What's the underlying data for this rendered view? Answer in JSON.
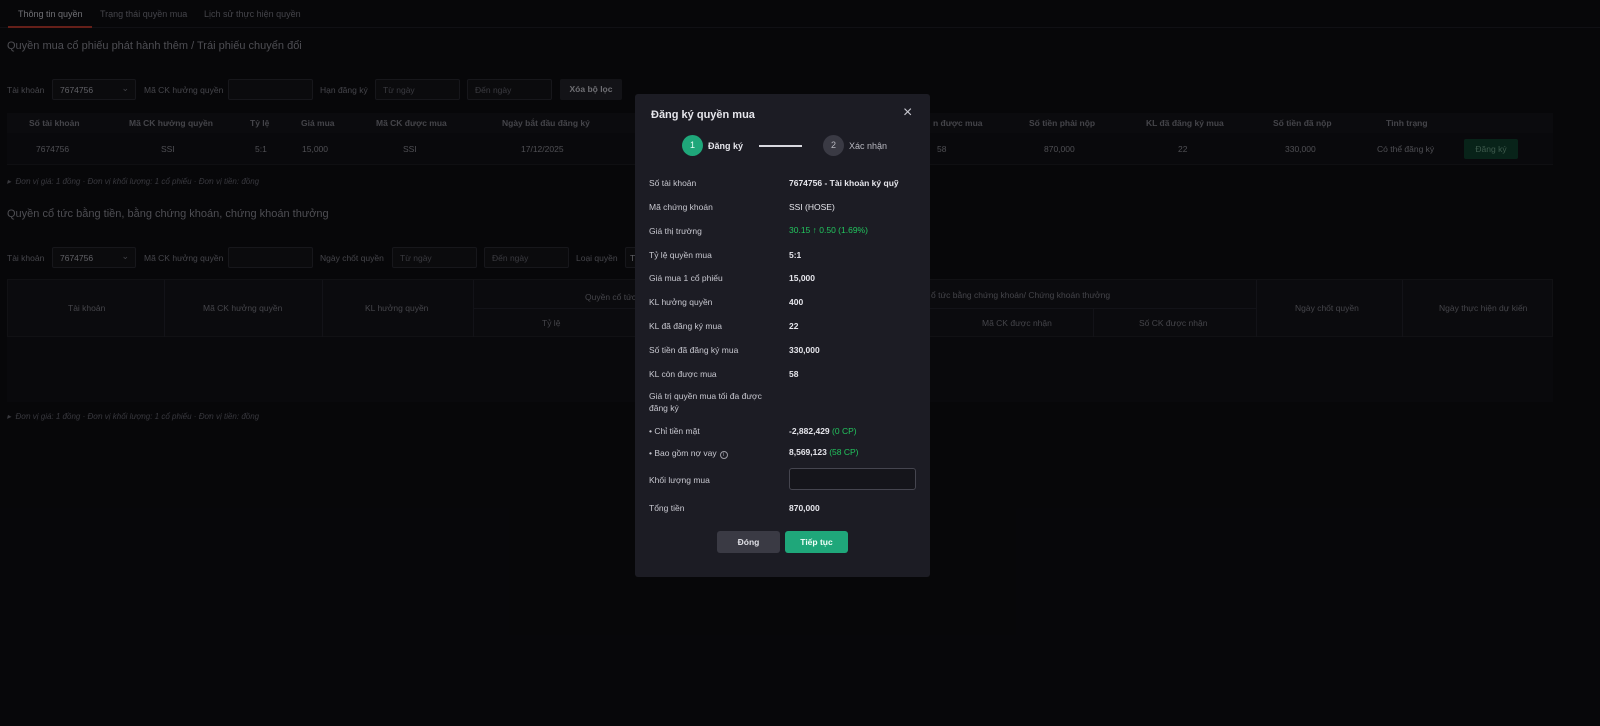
{
  "tabs": [
    "Thông tin quyền",
    "Trạng thái quyền mua",
    "Lịch sử thực hiện quyền"
  ],
  "section1": {
    "title": "Quyền mua cổ phiếu phát hành thêm / Trái phiếu chuyển đổi",
    "filters": {
      "account_label": "Tài khoản",
      "account_value": "7674756",
      "symbol_label": "Mã CK hưởng quyền",
      "deadline_label": "Hạn đăng ký",
      "from_placeholder": "Từ ngày",
      "to_placeholder": "Đến ngày",
      "clear_label": "Xóa bộ lọc"
    },
    "headers": [
      "Số tài khoản",
      "Mã CK hưởng quyền",
      "Tỷ lệ",
      "Giá mua",
      "Mã CK được mua",
      "Ngày bắt đầu đăng ký",
      "n được mua",
      "Số tiền phải nộp",
      "KL đã đăng ký mua",
      "Số tiền đã nộp",
      "Tình trạng"
    ],
    "row": {
      "account": "7674756",
      "symbol": "SSI",
      "ratio": "5:1",
      "price": "15,000",
      "buy_symbol": "SSI",
      "start_date": "17/12/2025",
      "remaining": "58",
      "amount_due": "870,000",
      "registered": "22",
      "paid": "330,000",
      "status": "Có thể đăng ký",
      "action": "Đăng ký"
    },
    "note": "Đơn vị giá: 1 đồng · Đơn vị khối lượng: 1 cổ phiếu · Đơn vị tiền: đồng"
  },
  "section2": {
    "title": "Quyền cổ tức bằng tiền, bằng chứng khoán, chứng khoán thưởng",
    "filters": {
      "account_label": "Tài khoản",
      "account_value": "7674756",
      "symbol_label": "Mã CK hưởng quyền",
      "record_label": "Ngày chốt quyền",
      "from_placeholder": "Từ ngày",
      "to_placeholder": "Đến ngày",
      "type_label": "Loại quyền",
      "type_value": "T"
    },
    "headers": {
      "account": "Tài khoản",
      "symbol": "Mã CK hưởng quyền",
      "volume": "KL hưởng quyền",
      "cash_group": "Quyền cổ tức",
      "ratio": "Tỷ lệ",
      "stock_group": "ổ tức bằng chứng khoán/ Chứng khoán thưởng",
      "received_symbol": "Mã CK được nhận",
      "received_qty": "Số CK được nhận",
      "record_date": "Ngày chốt quyền",
      "exec_date": "Ngày thực hiện dự kiến"
    },
    "note": "Đơn vị giá: 1 đồng · Đơn vị khối lượng: 1 cổ phiếu · Đơn vị tiền: đồng"
  },
  "modal": {
    "title": "Đăng ký quyền mua",
    "close_icon": "×",
    "steps": [
      {
        "num": "1",
        "label": "Đăng ký"
      },
      {
        "num": "2",
        "label": "Xác nhận"
      }
    ],
    "fields": {
      "account_label": "Số tài khoản",
      "account_value": "7674756 - Tài khoản ký quỹ",
      "symbol_label": "Mã chứng khoán",
      "symbol_value": "SSI (HOSE)",
      "market_label": "Giá thị trường",
      "market_price": "30.15",
      "market_arrow": "↑",
      "market_change": "0.50 (1.69%)",
      "ratio_label": "Tỷ lệ quyền mua",
      "ratio_value": "5:1",
      "price_label": "Giá mua 1 cổ phiếu",
      "price_value": "15,000",
      "entitled_label": "KL hưởng quyền",
      "entitled_value": "400",
      "registered_label": "KL đã đăng ký mua",
      "registered_value": "22",
      "amount_label": "Số tiền đã đăng ký mua",
      "amount_value": "330,000",
      "remaining_label": "KL còn được mua",
      "remaining_value": "58",
      "max_label": "Giá trị quyền mua tối đa được đăng ký",
      "cash_label": "• Chỉ tiền mặt",
      "cash_value": "-2,882,429",
      "cash_cp": "(0 CP)",
      "loan_label": "• Bao gồm nợ vay",
      "loan_value": "8,569,123",
      "loan_cp": "(58 CP)",
      "qty_label": "Khối lượng mua",
      "total_label": "Tổng tiền",
      "total_value": "870,000"
    },
    "close_label": "Đóng",
    "next_label": "Tiếp tục"
  },
  "colors": {
    "accent": "#1fa77a",
    "positive": "#22c55e",
    "tab_underline": "#b8392f"
  }
}
